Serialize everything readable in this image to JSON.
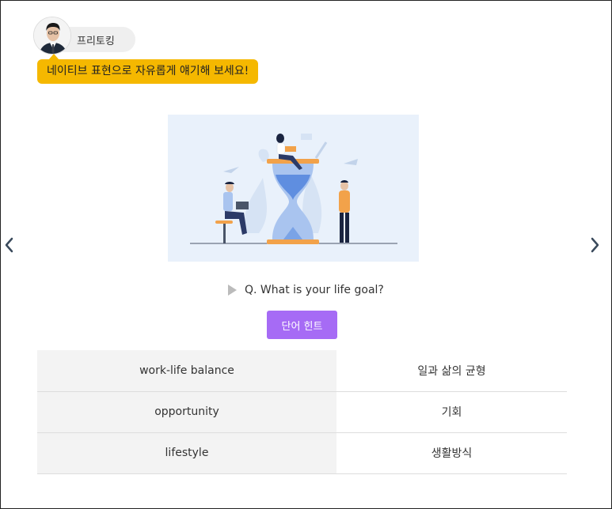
{
  "tutor": {
    "name": "프리토킹",
    "instruction": "네이티브 표현으로 자유롭게 얘기해 보세요!"
  },
  "question": {
    "text": "Q. What is your life goal?"
  },
  "hint_button": {
    "label": "단어 힌트"
  },
  "vocabulary": [
    {
      "en": "work-life balance",
      "ko": "일과 삶의 균형"
    },
    {
      "en": "opportunity",
      "ko": "기회"
    },
    {
      "en": "lifestyle",
      "ko": "생활방식"
    }
  ],
  "colors": {
    "speech_bubble": "#f5b800",
    "hint_button": "#a66bf5",
    "illustration_bg": "#e9f1fb"
  },
  "icons": {
    "prev": "chevron-left-icon",
    "next": "chevron-right-icon",
    "play": "play-icon"
  }
}
